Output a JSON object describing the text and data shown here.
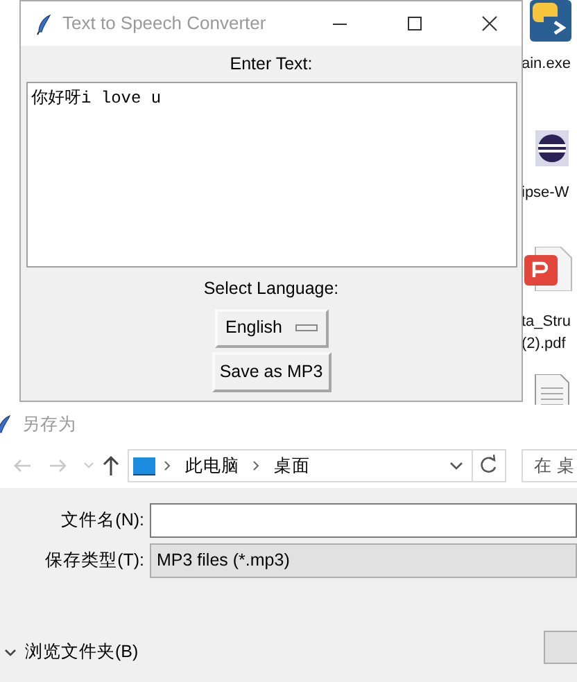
{
  "desktop_icons": [
    {
      "kind": "python",
      "lines": [
        "ain.exe"
      ]
    },
    {
      "kind": "eclipse",
      "lines": [
        "ipse-W"
      ]
    },
    {
      "kind": "pdf",
      "lines": [
        "ta_Stru",
        "(2).pdf"
      ]
    },
    {
      "kind": "text"
    }
  ],
  "app_window": {
    "title": "Text to Speech Converter",
    "text_label": "Enter Text:",
    "text_value": "你好呀i love u",
    "language_label": "Select Language:",
    "language": "English",
    "save_button": "Save as MP3"
  },
  "save_dialog": {
    "title": "另存为",
    "path": [
      "此电脑",
      "桌面"
    ],
    "search_placeholder": "在 桌",
    "file_name_label": "文件名(N):",
    "file_type_label": "保存类型(T):",
    "file_type": "MP3 files (*.mp3)",
    "browse_folders": "浏览文件夹(B)"
  }
}
